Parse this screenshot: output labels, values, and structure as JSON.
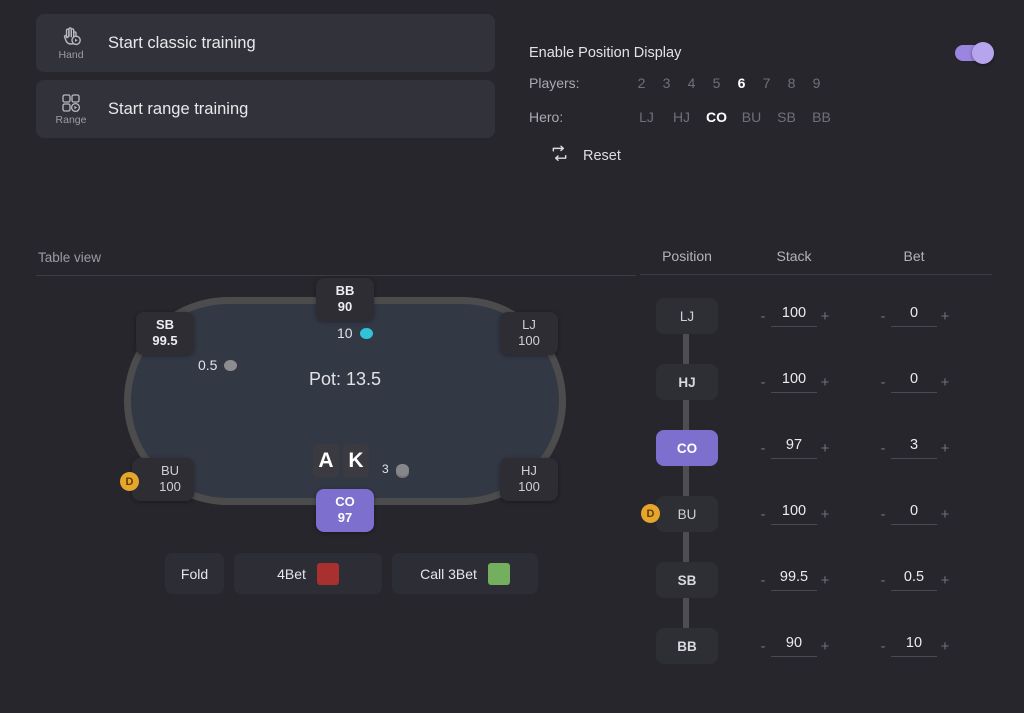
{
  "training": {
    "buttons": [
      {
        "icon": "hand-icon",
        "icon_label": "Hand",
        "label": "Start classic training"
      },
      {
        "icon": "range-grid-icon",
        "icon_label": "Range",
        "label": "Start range training"
      }
    ]
  },
  "settings": {
    "position_display_label": "Enable Position Display",
    "position_display_on": true,
    "players_label": "Players:",
    "players_options": [
      "2",
      "3",
      "4",
      "5",
      "6",
      "7",
      "8",
      "9"
    ],
    "players_selected": "6",
    "hero_label": "Hero:",
    "hero_options": [
      "LJ",
      "HJ",
      "CO",
      "BU",
      "SB",
      "BB"
    ],
    "hero_selected": "CO",
    "reset_label": "Reset",
    "reset_icon": "repeat-icon"
  },
  "table_view": {
    "label": "Table view",
    "pot_label": "Pot: 13.5",
    "hero_cards": [
      "A",
      "K"
    ],
    "hero_bet": {
      "amount": "3",
      "chip": "grey-stack"
    },
    "seats": [
      {
        "position": "BB",
        "stack": "90",
        "hero": false,
        "dealer": false
      },
      {
        "position": "LJ",
        "stack": "100",
        "hero": false,
        "dealer": false
      },
      {
        "position": "HJ",
        "stack": "100",
        "hero": false,
        "dealer": false
      },
      {
        "position": "CO",
        "stack": "97",
        "hero": true,
        "dealer": false
      },
      {
        "position": "BU",
        "stack": "100",
        "hero": false,
        "dealer": true
      },
      {
        "position": "SB",
        "stack": "99.5",
        "hero": false,
        "dealer": false
      }
    ],
    "bets": [
      {
        "who": "BB",
        "amount": "10",
        "chip": "cyan"
      },
      {
        "who": "SB",
        "amount": "0.5",
        "chip": "grey"
      }
    ],
    "dealer_badge": "D"
  },
  "actions": [
    {
      "label": "Fold",
      "swatch": null
    },
    {
      "label": "4Bet",
      "swatch": "#a8312f"
    },
    {
      "label": "Call 3Bet",
      "swatch": "#74ae5f"
    }
  ],
  "grid": {
    "headers": {
      "position": "Position",
      "stack": "Stack",
      "bet": "Bet"
    },
    "minus": "-",
    "plus": "+",
    "rows": [
      {
        "position": "LJ",
        "stack": "100",
        "bet": "0",
        "hero": false,
        "dealer": false
      },
      {
        "position": "HJ",
        "stack": "100",
        "bet": "0",
        "hero": false,
        "dealer": false
      },
      {
        "position": "CO",
        "stack": "97",
        "bet": "3",
        "hero": true,
        "dealer": false
      },
      {
        "position": "BU",
        "stack": "100",
        "bet": "0",
        "hero": false,
        "dealer": true
      },
      {
        "position": "SB",
        "stack": "99.5",
        "bet": "0.5",
        "hero": false,
        "dealer": false
      },
      {
        "position": "BB",
        "stack": "90",
        "bet": "10",
        "hero": false,
        "dealer": false
      }
    ],
    "dealer_badge": "D"
  },
  "colors": {
    "background": "#26262c",
    "panel": "#32323a",
    "accent_purple": "#7c6fce",
    "toggle_on": "#9a86e0",
    "dealer_yellow": "#e8a52c",
    "felt": "#333845",
    "rail": "#4c4c4c",
    "chip_cyan": "#2fc4d8",
    "chip_grey": "#8d8d91",
    "swatch_red": "#a8312f",
    "swatch_green": "#74ae5f"
  }
}
